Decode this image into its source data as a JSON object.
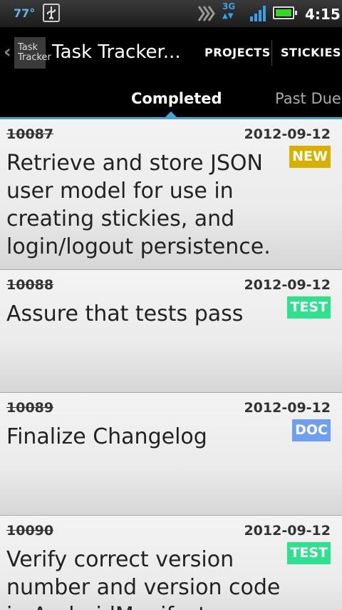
{
  "status_bar": {
    "temperature": "77°",
    "network": "3G",
    "time": "4:15",
    "icons": [
      "usb-icon",
      "sync-icon",
      "signal-icon",
      "battery-icon"
    ]
  },
  "action_bar": {
    "logo_line1": "Task",
    "logo_line2": "Tracker",
    "title": "Task Tracker...",
    "projects": "PROJECTS",
    "stickies": "STICKIES"
  },
  "tabs": {
    "active": "Completed",
    "inactive": "Past Due",
    "accent_color": "#3ea6d9"
  },
  "tasks": [
    {
      "id": "10087",
      "date": "2012-09-12",
      "badge": "NEW",
      "badge_color": "#d8b000",
      "title": "Retrieve and store JSON user model for use in creating stickies, and login/logout persistence."
    },
    {
      "id": "10088",
      "date": "2012-09-12",
      "badge": "TEST",
      "badge_color": "#2fe08e",
      "title": "Assure that tests pass"
    },
    {
      "id": "10089",
      "date": "2012-09-12",
      "badge": "DOC",
      "badge_color": "#6f9ff0",
      "title": "Finalize Changelog"
    },
    {
      "id": "10090",
      "date": "2012-09-12",
      "badge": "TEST",
      "badge_color": "#2fe08e",
      "title": "Verify correct version number and version code in AndroidManifest"
    }
  ]
}
